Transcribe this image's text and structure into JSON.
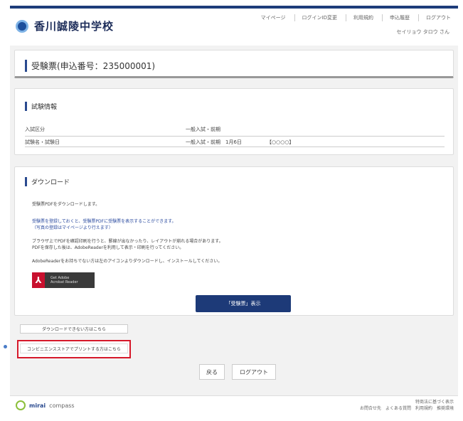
{
  "header": {
    "school_name": "香川誠陵中学校",
    "nav": [
      "マイページ",
      "ログインID変更",
      "利用規約",
      "申込履歴",
      "ログアウト"
    ],
    "username": "セイリョウ タロウ さん"
  },
  "page_title": "受験票(申込番号：235000001)",
  "exam_info": {
    "heading": "試験情報",
    "rows": [
      {
        "label": "入試区分",
        "value": "一般入試・前期",
        "extra": ""
      },
      {
        "label": "試験名・試験日",
        "value": "一般入試・前期　1月6日",
        "extra": "【○○○○】"
      }
    ]
  },
  "download": {
    "heading": "ダウンロード",
    "line1": "受験票PDFをダウンロードします。",
    "line2": "受験票を登録しておくと、受験票PDFに受験票を表示することができます。",
    "line3": "（写真の登録はマイページより行えます）",
    "line4": "ブラウザ上でPDFを確認印刷を行うと、罫線が出なかったり、レイアウトが崩れる場合があります。",
    "line5": "PDFを保存した後は、AdobeReaderを利用して表示・印刷を行ってください。",
    "line6": "AdobeReaderをお持ちでない方は左のアイコンよりダウンロードし、インストールしてください。",
    "adobe_line1": "Get Adobe",
    "adobe_line2": "Acrobat Reader",
    "button": "「受験票」表示"
  },
  "help_button": "ダウンロードできない方はこちら",
  "mail_button": "コンビニエンスストアでプリントする方はこちら",
  "back_button": "戻る",
  "logout_button": "ログアウト",
  "footer": {
    "brand_bold": "mirai",
    "brand_rest": "compass",
    "links_line1": "特商法に基づく表示",
    "links_line2": "お問合せ先　よくある質問　利用規約　推奨環境"
  }
}
